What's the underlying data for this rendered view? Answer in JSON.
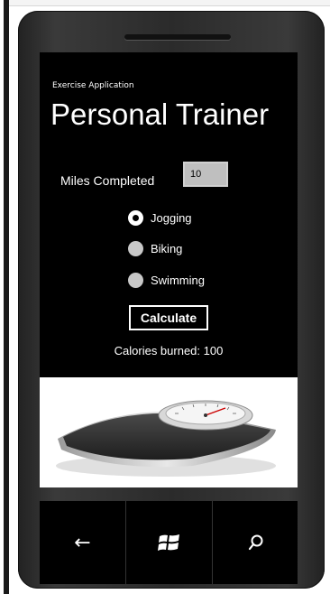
{
  "app": {
    "subtitle": "Exercise Application",
    "title": "Personal Trainer"
  },
  "form": {
    "miles_label": "Miles Completed",
    "miles_value": "10",
    "exercise_options": [
      {
        "label": "Jogging",
        "selected": true
      },
      {
        "label": "Biking",
        "selected": false
      },
      {
        "label": "Swimming",
        "selected": false
      }
    ],
    "calculate_label": "Calculate",
    "result_text": "Calories burned: 100"
  },
  "image": {
    "subject": "bathroom-scale"
  },
  "nav": {
    "back_icon": "back-arrow-icon",
    "start_icon": "windows-logo-icon",
    "search_icon": "search-icon"
  }
}
